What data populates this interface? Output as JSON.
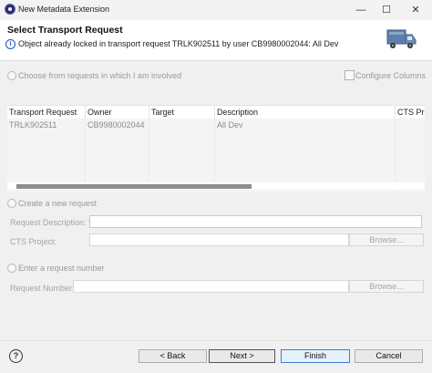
{
  "window": {
    "title": "New Metadata Extension",
    "minimize_glyph": "—",
    "maximize_glyph": "☐",
    "close_glyph": "✕",
    "app_icon": "eclipse-icon"
  },
  "header": {
    "title": "Select Transport Request",
    "message": "Object already locked in transport request TRLK902511 by user CB9980002044: All Dev",
    "message_icon": "info-icon",
    "banner_icon": "truck-icon"
  },
  "choose_requests": {
    "label": "Choose from requests in which I am involved",
    "configure_columns_label": "Configure Columns"
  },
  "table": {
    "columns": [
      "Transport Request",
      "Owner",
      "Target",
      "Description",
      "CTS Proj"
    ],
    "rows": [
      [
        "TRLK902511",
        "CB9980002044",
        "",
        "All Dev",
        ""
      ]
    ]
  },
  "create_request": {
    "label": "Create a new request",
    "description_label": "Request Description: *",
    "description_value": "",
    "cts_label": "CTS Project:",
    "cts_value": "",
    "browse_label": "Browse..."
  },
  "enter_request": {
    "label": "Enter a request number",
    "number_label": "Request Number:",
    "number_value": "",
    "browse_label": "Browse..."
  },
  "footer": {
    "help_glyph": "?",
    "back_label": "< Back",
    "next_label": "Next >",
    "finish_label": "Finish",
    "cancel_label": "Cancel"
  },
  "colors": {
    "accent": "#3c7fd0",
    "info": "#1a56c4",
    "disabled_text": "#a4a4a4"
  }
}
